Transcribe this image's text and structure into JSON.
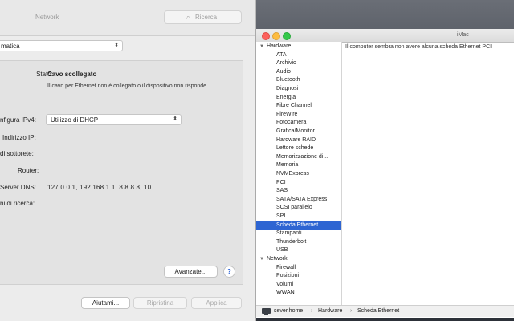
{
  "network": {
    "title": "Network",
    "search_placeholder": "Ricerca",
    "location_value": "matica",
    "status_label": "Stato:",
    "status_value": "Cavo scollegato",
    "status_desc": "Il cavo per Ethernet non è collegato o il dispositivo non risponde.",
    "ipv4_label": "nfigura IPv4:",
    "ipv4_value": "Utilizzo di DHCP",
    "ip_label": "Indirizzo IP:",
    "subnet_label": "di sottorete:",
    "router_label": "Router:",
    "dns_label": "Server DNS:",
    "dns_value": "127.0.0.1, 192.168.1.1, 8.8.8.8, 10....",
    "search_domains_label": "ni di ricerca:",
    "advanced_button": "Avanzate...",
    "help_icon_glyph": "?",
    "help_button": "Aiutami...",
    "revert_button": "Ripristina",
    "apply_button": "Applica"
  },
  "sysinfo": {
    "title": "iMac",
    "message": "Il computer sembra non avere alcuna scheda Ethernet PCI",
    "groups": [
      {
        "label": "Hardware"
      },
      {
        "label": "Network"
      }
    ],
    "hardware_items": [
      "ATA",
      "Archivio",
      "Audio",
      "Bluetooth",
      "Diagnosi",
      "Energia",
      "Fibre Channel",
      "FireWire",
      "Fotocamera",
      "Grafica/Monitor",
      "Hardware RAID",
      "Lettore schede",
      "Memorizzazione di...",
      "Memoria",
      "NVMExpress",
      "PCI",
      "SAS",
      "SATA/SATA Express",
      "SCSI parallelo",
      "SPI",
      "Scheda Ethernet",
      "Stampanti",
      "Thunderbolt",
      "USB"
    ],
    "network_items": [
      "Firewall",
      "Posizioni",
      "Volumi",
      "WWAN"
    ],
    "selected_item": "Scheda Ethernet",
    "path": [
      "sever.home",
      "Hardware",
      "Scheda Ethernet"
    ],
    "path_separator": "›",
    "selected_color": "#2e65d2"
  }
}
